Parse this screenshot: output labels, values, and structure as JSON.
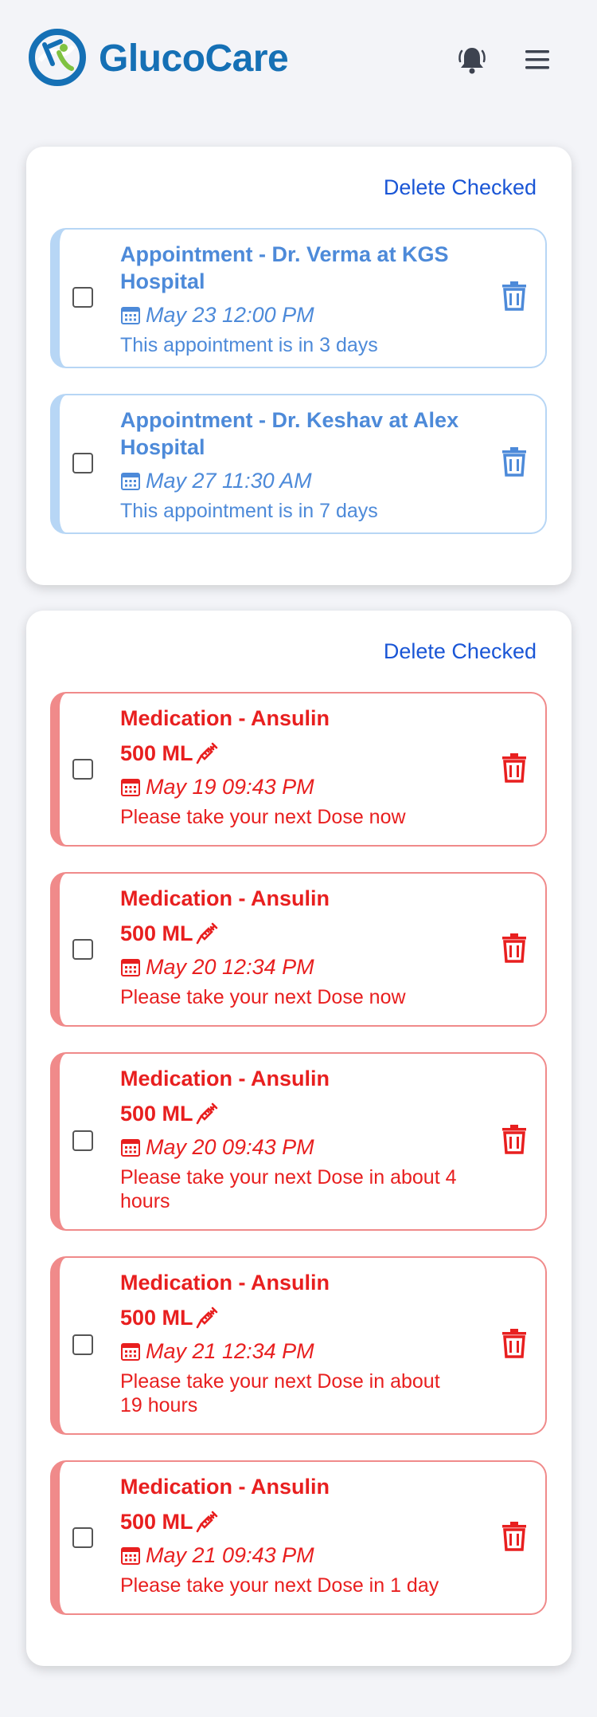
{
  "app": {
    "name": "GlucoCare"
  },
  "colors": {
    "brand": "#1570b5",
    "appointment": "#4d8ad9",
    "medication": "#e81f1f",
    "link": "#1a56d6"
  },
  "icons": {
    "logo": "glucocare-logo-icon",
    "notifications": "bell-icon",
    "menu": "hamburger-menu-icon",
    "date": "calendar-icon",
    "dose": "syringe-icon",
    "delete": "trash-icon"
  },
  "appointments": {
    "delete_checked": "Delete Checked",
    "items": [
      {
        "title": "Appointment - Dr. Verma at KGS Hospital",
        "date": "May 23 12:00 PM",
        "note": "This appointment is in 3 days"
      },
      {
        "title": "Appointment - Dr. Keshav at Alex Hospital",
        "date": "May 27 11:30 AM",
        "note": "This appointment is in 7 days"
      }
    ]
  },
  "medications": {
    "delete_checked": "Delete Checked",
    "items": [
      {
        "title": "Medication - Ansulin",
        "dose": "500 ML",
        "date": "May 19 09:43 PM",
        "note": "Please take your next Dose now"
      },
      {
        "title": "Medication - Ansulin",
        "dose": "500 ML",
        "date": "May 20 12:34 PM",
        "note": "Please take your next Dose now"
      },
      {
        "title": "Medication - Ansulin",
        "dose": "500 ML",
        "date": "May 20 09:43 PM",
        "note": "Please take your next Dose in about 4 hours"
      },
      {
        "title": "Medication - Ansulin",
        "dose": "500 ML",
        "date": "May 21 12:34 PM",
        "note": "Please take your next Dose in about 19 hours"
      },
      {
        "title": "Medication - Ansulin",
        "dose": "500 ML",
        "date": "May 21 09:43 PM",
        "note": "Please take your next Dose in 1 day"
      }
    ]
  }
}
